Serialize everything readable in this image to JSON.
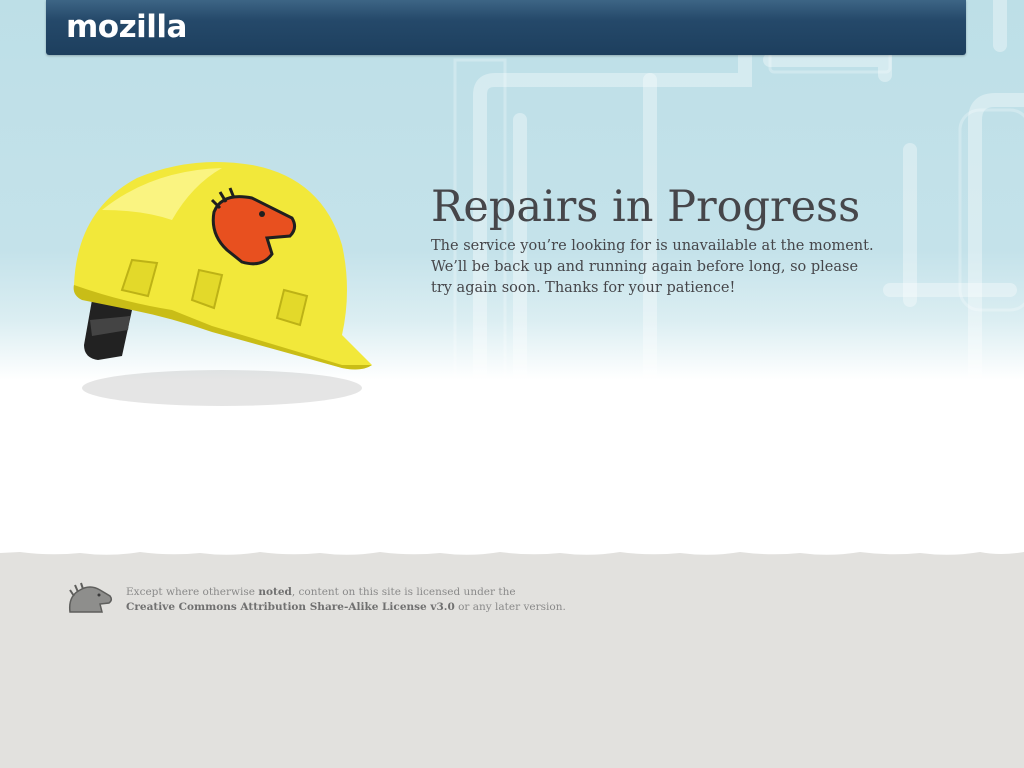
{
  "header": {
    "logo_text": "mozilla",
    "bar_color": "#1d3f5e"
  },
  "main": {
    "title": "Repairs in Progress",
    "message_line1": "The service you’re looking for is unavailable at the moment.",
    "message_line2": "We’ll be back up and running again before long, so please",
    "message_line3": "try again soon. Thanks for your patience!"
  },
  "footer": {
    "license_prefix": "Except where otherwise ",
    "noted_link": "noted",
    "license_middle": ", content on this site is licensed under the",
    "license_link": "Creative Commons Attribution Share-Alike License v3.0",
    "license_suffix": " or any later version."
  },
  "icons": {
    "helmet": "hard-hat-icon",
    "dino": "mozilla-dino-icon"
  },
  "colors": {
    "helmet_yellow": "#f2e83a",
    "dino_red": "#e8501f",
    "sky_blue": "#c4e2ea",
    "footer_gray": "#e2e1de",
    "text": "#46464a"
  }
}
